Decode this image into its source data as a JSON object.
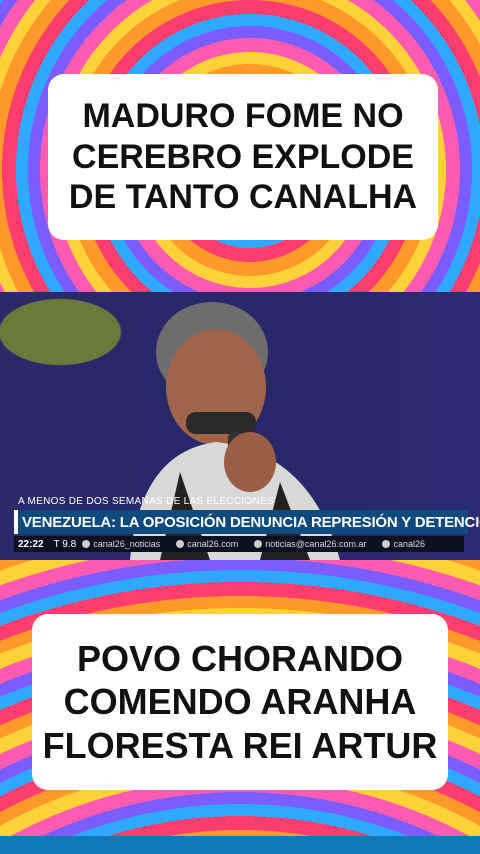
{
  "top_caption": "MADURO FOME NO\nCEREBRO EXPLODE\nDE TANTO CANALHA",
  "bottom_caption": "POVO CHORANDO\nCOMENDO ARANHA\nFLORESTA REI ARTUR",
  "video": {
    "kicker": "A MENOS DE DOS SEMANAS DE LAS ELECCIONES",
    "headline": "VENEZUELA: LA OPOSICIÓN DENUNCIA REPRESIÓN Y DETENCIONES",
    "clock": "22:22",
    "temperature": "T 9.8",
    "ticker": [
      {
        "icon": "twitter-icon",
        "text": "canal26_noticias"
      },
      {
        "icon": "globe-icon",
        "text": "canal26.com"
      },
      {
        "icon": "email-icon",
        "text": "noticias@canal26.com.ar"
      },
      {
        "icon": "instagram-icon",
        "text": "canal26"
      }
    ]
  },
  "colors": {
    "headline_bar": "#0f4a7e",
    "ticker_bg": "#0b1020",
    "bottom_strip": "#0e7bb8"
  }
}
